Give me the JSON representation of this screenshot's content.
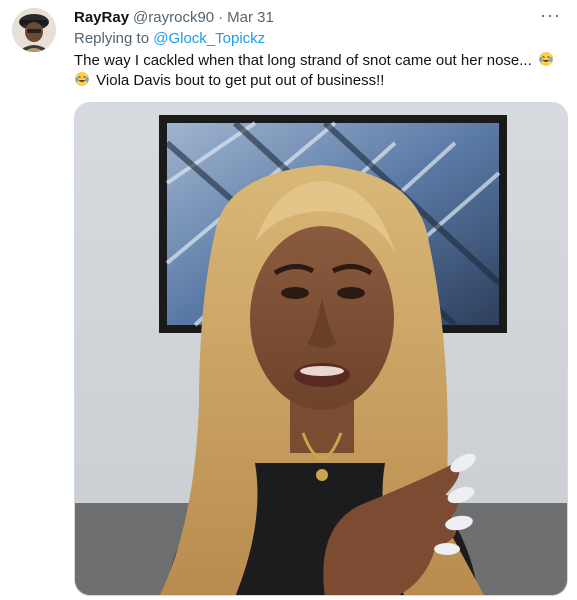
{
  "tweet": {
    "display_name": "RayRay",
    "handle": "@rayrock90",
    "separator": "·",
    "date": "Mar 31",
    "more_icon": "more-horizontal-icon",
    "replying_prefix": "Replying to",
    "replying_to": "@Glock_Topickz",
    "text_line1": "The way I cackled when that long strand of snot came out her nose...",
    "text_line2": "Viola Davis bout to get put out of business!!",
    "emoji": "face-with-tears-of-joy",
    "media_alt": "Video still of a woman with long blonde wavy hair speaking to camera in front of framed abstract artwork",
    "colors": {
      "text": "#0f1419",
      "muted": "#536471",
      "link": "#1d9bf0",
      "border": "#cfd9de"
    }
  }
}
